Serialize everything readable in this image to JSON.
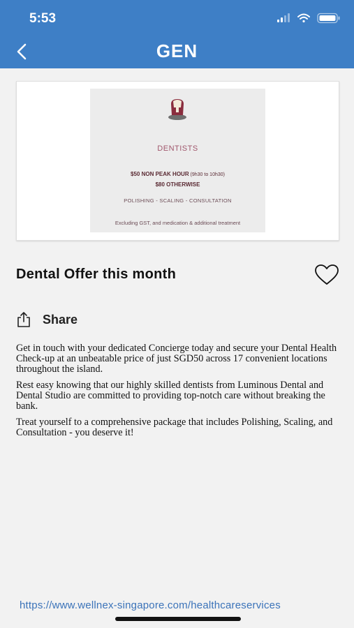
{
  "status_bar": {
    "time": "5:53",
    "icons": [
      "signal-icon",
      "wifi-icon",
      "battery-icon"
    ]
  },
  "header": {
    "logo": "GEN",
    "background_color": "#3e7fc6"
  },
  "offer_image": {
    "category": "DENTISTS",
    "line1_bold": "$50 NON PEAK HOUR",
    "line1_small": " (9h30 to 10h30)",
    "line2": "$80 OTHERWISE",
    "services": "POLISHING - SCALING - CONSULTATION",
    "note": "Excluding GST, and medication & additional treatment"
  },
  "offer": {
    "title": "Dental Offer this month",
    "share_label": "Share",
    "paragraphs": [
      "Get in touch with your dedicated Concierge today and secure your Dental Health Check-up at an unbeatable price of just SGD50 across 17 convenient locations throughout the island.",
      "Rest easy knowing that our highly skilled dentists from Luminous Dental and Dental Studio are committed to providing top-notch care without breaking the bank.",
      "Treat yourself to a comprehensive package that includes Polishing, Scaling, and Consultation - you deserve it!"
    ],
    "link": "https://www.wellnex-singapore.com/healthcareservices"
  }
}
